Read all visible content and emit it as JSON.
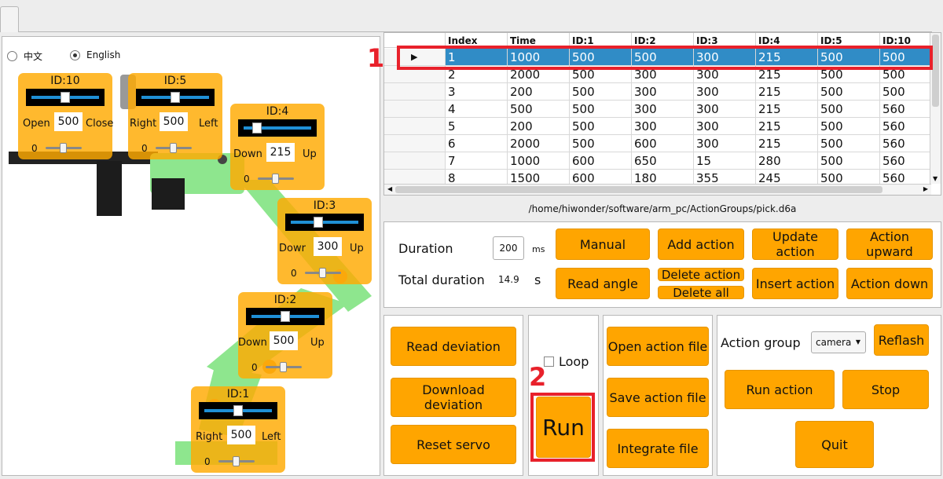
{
  "language": {
    "chinese": "中文",
    "english": "English",
    "selected": "English"
  },
  "servos": [
    {
      "id": "ID:10",
      "left_label": "Open",
      "right_label": "Close",
      "value": "500",
      "min": "0"
    },
    {
      "id": "ID:5",
      "left_label": "Right",
      "right_label": "Left",
      "value": "500",
      "min": "0"
    },
    {
      "id": "ID:4",
      "left_label": "Down",
      "right_label": "Up",
      "value": "215",
      "min": "0"
    },
    {
      "id": "ID:3",
      "left_label": "Dowr",
      "right_label": "Up",
      "value": "300",
      "min": "0"
    },
    {
      "id": "ID:2",
      "left_label": "Down",
      "right_label": "Up",
      "value": "500",
      "min": "0"
    },
    {
      "id": "ID:1",
      "left_label": "Right",
      "right_label": "Left",
      "value": "500",
      "min": "0"
    }
  ],
  "table": {
    "headers": [
      "",
      "Index",
      "Time",
      "ID:1",
      "ID:2",
      "ID:3",
      "ID:4",
      "ID:5",
      "ID:10"
    ],
    "rows": [
      [
        "1",
        "1000",
        "500",
        "500",
        "300",
        "215",
        "500",
        "500"
      ],
      [
        "2",
        "2000",
        "500",
        "300",
        "300",
        "215",
        "500",
        "500"
      ],
      [
        "3",
        "200",
        "500",
        "300",
        "300",
        "215",
        "500",
        "500"
      ],
      [
        "4",
        "500",
        "500",
        "300",
        "300",
        "215",
        "500",
        "560"
      ],
      [
        "5",
        "200",
        "500",
        "300",
        "300",
        "215",
        "500",
        "560"
      ],
      [
        "6",
        "2000",
        "500",
        "600",
        "300",
        "215",
        "500",
        "560"
      ],
      [
        "7",
        "1000",
        "600",
        "650",
        "15",
        "280",
        "500",
        "560"
      ],
      [
        "8",
        "1500",
        "600",
        "180",
        "355",
        "245",
        "500",
        "560"
      ]
    ]
  },
  "file_path": "/home/hiwonder/software/arm_pc/ActionGroups/pick.d6a",
  "controls": {
    "duration_label": "Duration",
    "duration_value": "200",
    "duration_unit": "ms",
    "total_label": "Total duration",
    "total_value": "14.9",
    "total_unit": "s",
    "manual": "Manual",
    "add_action": "Add action",
    "update_action": "Update action",
    "action_upward": "Action upward",
    "read_angle": "Read angle",
    "delete_action": "Delete action",
    "delete_all": "Delete all",
    "insert_action": "Insert action",
    "action_down": "Action down"
  },
  "deviation": {
    "read": "Read deviation",
    "download": "Download deviation",
    "reset": "Reset servo"
  },
  "run": {
    "loop_label": "Loop",
    "run_label": "Run"
  },
  "files": {
    "open": "Open action file",
    "save": "Save action file",
    "integrate": "Integrate file"
  },
  "group": {
    "label": "Action group",
    "selected": "camera",
    "reflash": "Reflash",
    "run_action": "Run action",
    "stop": "Stop",
    "quit": "Quit"
  },
  "annotations": {
    "one": "1",
    "two": "2"
  },
  "colors": {
    "button": "#ffa500",
    "selection": "#308cc6",
    "highlight": "#e8212b",
    "arm": "#8ee68e"
  }
}
